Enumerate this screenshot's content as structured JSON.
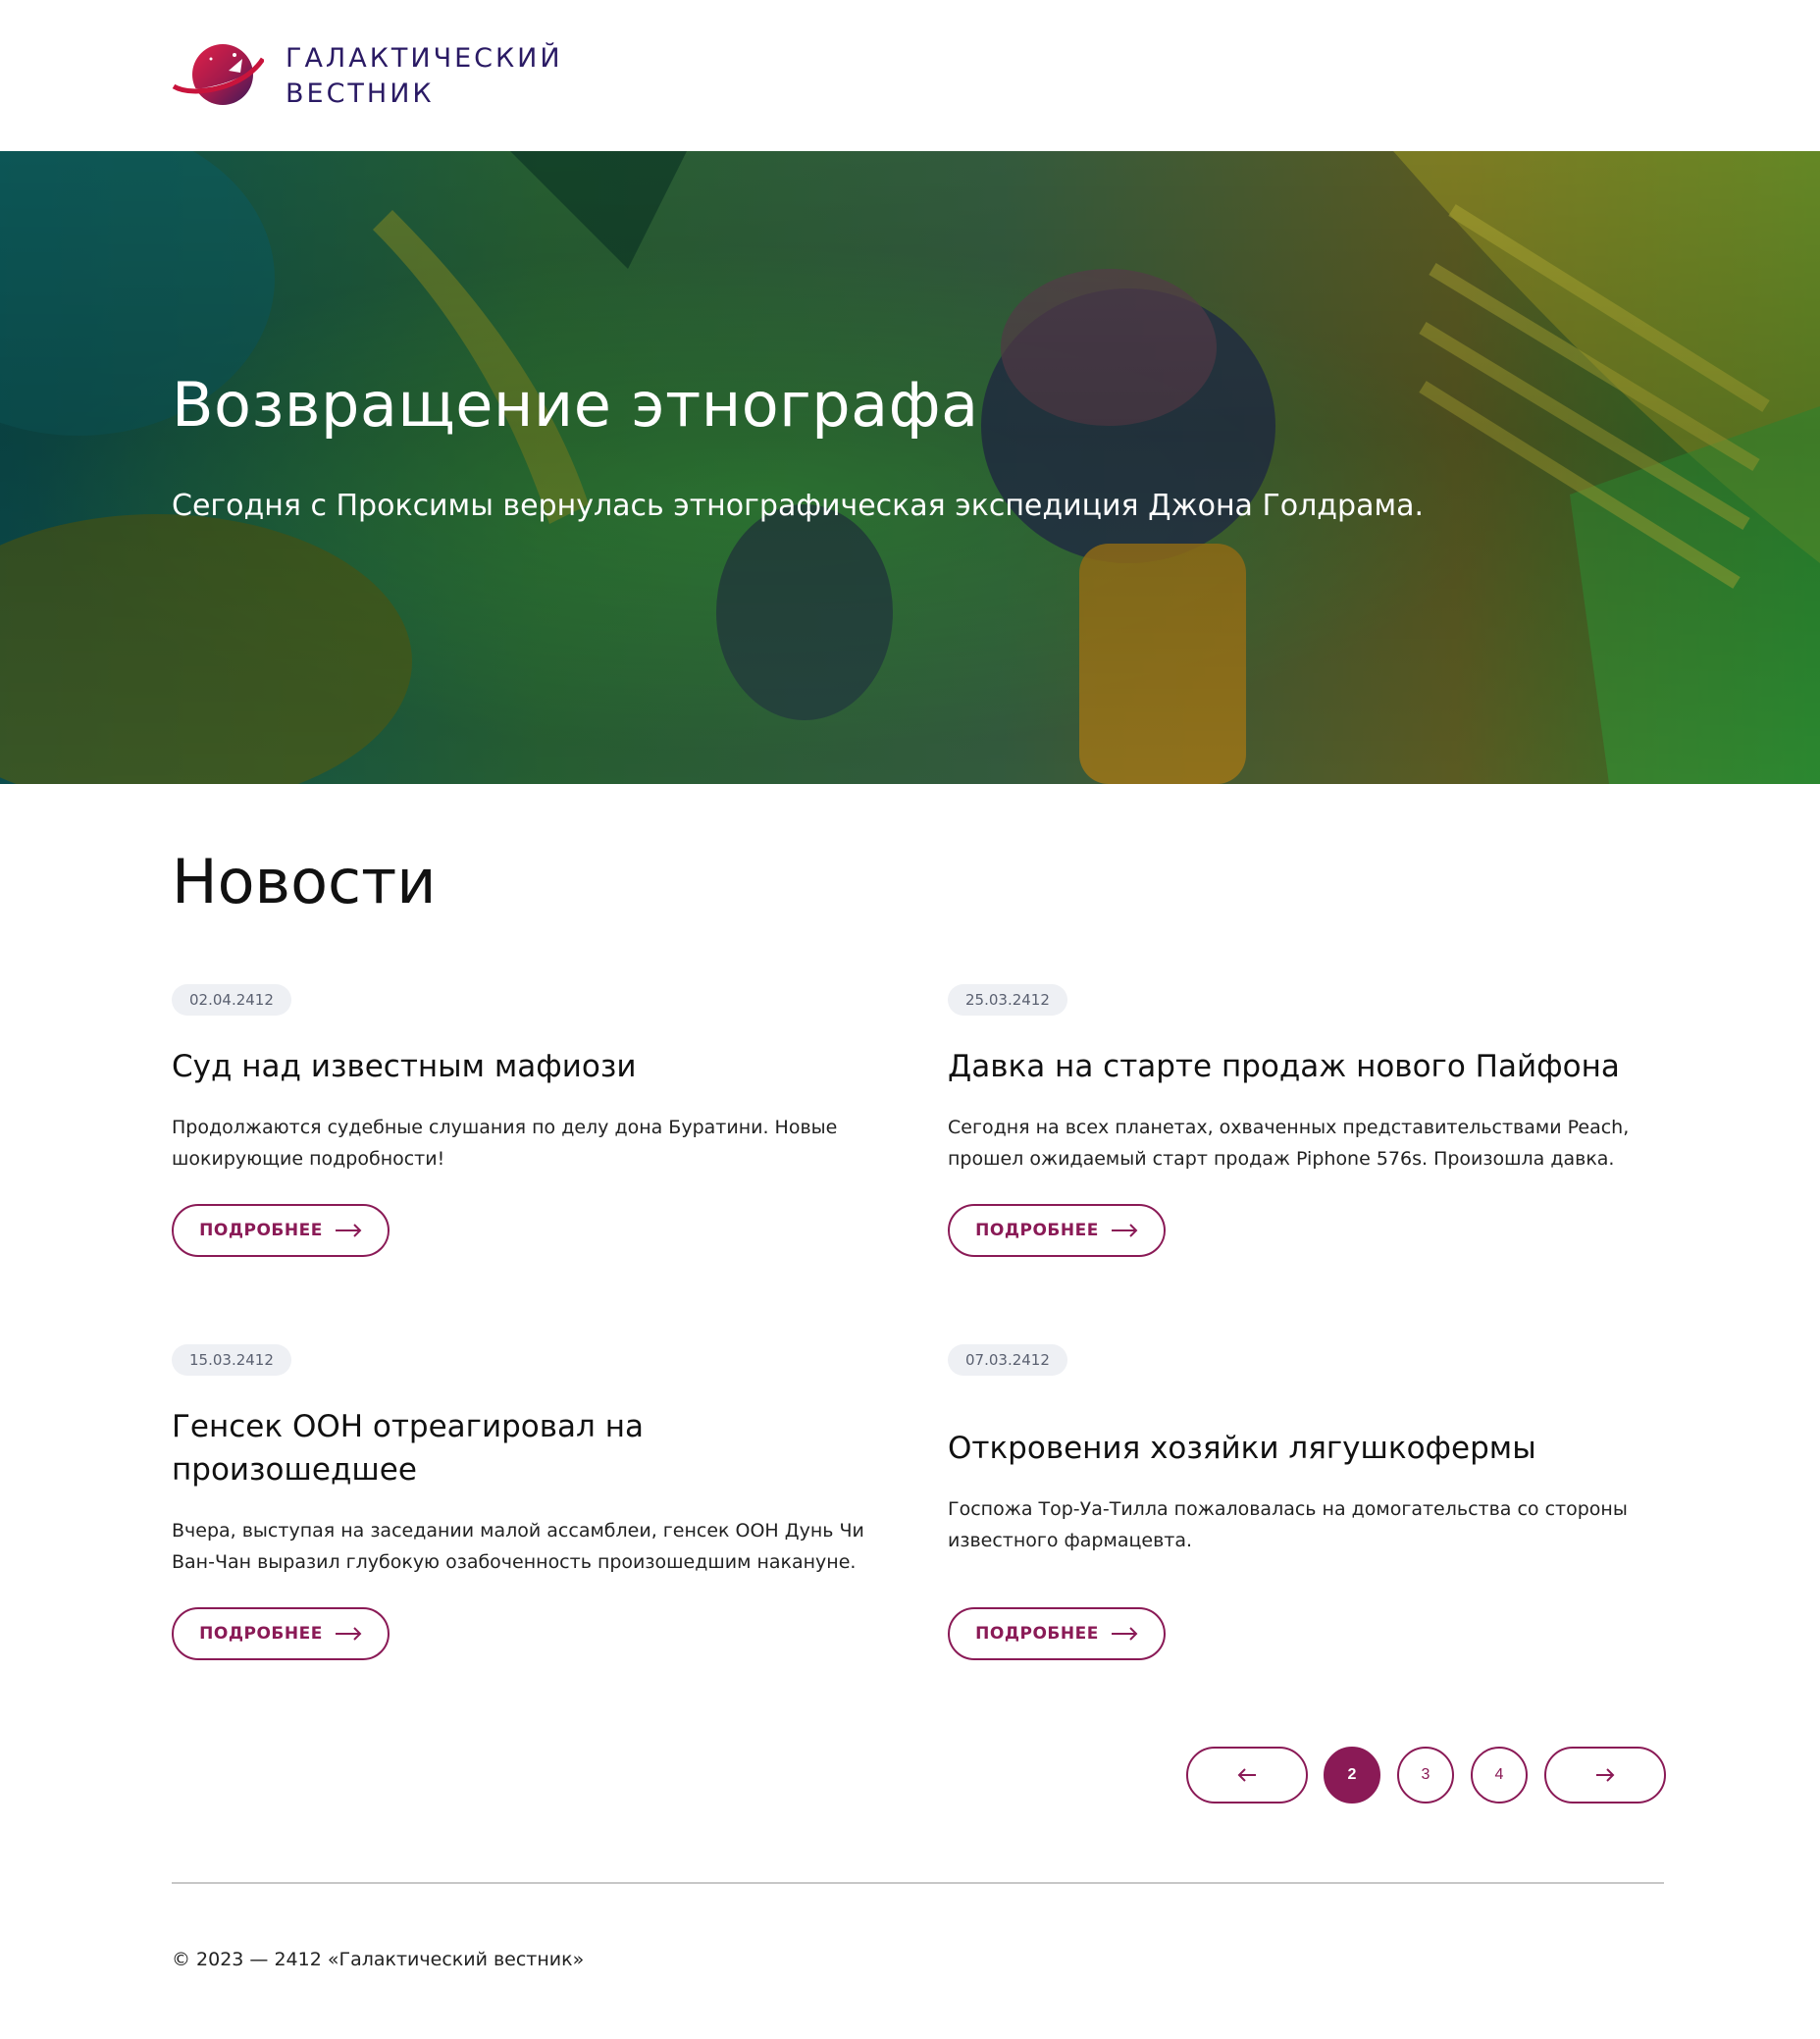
{
  "colors": {
    "accent": "#8a1a56",
    "logo_text": "#2a1a64",
    "date_badge_bg": "#eef0f4"
  },
  "header": {
    "logo_icon": "planet-rocket-icon",
    "logo_line1": "Галактический",
    "logo_line2": "вестник"
  },
  "hero": {
    "title": "Возвращение этнографа",
    "subtitle": "Сегодня с Проксимы вернулась этнографическая экспедиция Джона Голдрама."
  },
  "news": {
    "title": "Новости",
    "more_label": "ПОДРОБНЕЕ",
    "more_icon": "arrow-right-icon",
    "items": [
      {
        "date": "02.04.2412",
        "title": "Суд над известным мафиози",
        "text_line1": "Продолжаются судебные слушания по делу дона Буратини. Новые",
        "text_line2": "шокирующие подробности!"
      },
      {
        "date": "25.03.2412",
        "title": "Давка на старте продаж нового Пайфона",
        "text_line1": "Сегодня на всех планетах, охваченных представительствами Peach,",
        "text_line2": "прошел ожидаемый старт продаж Piphone 576s. Произошла давка."
      },
      {
        "date": "15.03.2412",
        "title_line1": "Генсек ООН отреагировал на",
        "title_line2": "произошедшее",
        "text_line1": "Вчера, выступая на заседании малой ассамблеи, генсек ООН Дунь Чи",
        "text_line2": "Ван-Чан выразил глубокую озабоченность произошедшим накануне."
      },
      {
        "date": "07.03.2412",
        "title": "Откровения хозяйки лягушкофермы",
        "text_line1": "Госпожа Тор-Уа-Тилла пожаловалась на домогательства со стороны",
        "text_line2": "известного фармацевта."
      }
    ]
  },
  "pagination": {
    "prev_icon": "arrow-left-icon",
    "next_icon": "arrow-right-icon",
    "pages": [
      "2",
      "3",
      "4"
    ],
    "current": "2"
  },
  "footer": {
    "copyright": "© 2023 — 2412 «Галактический вестник»"
  }
}
